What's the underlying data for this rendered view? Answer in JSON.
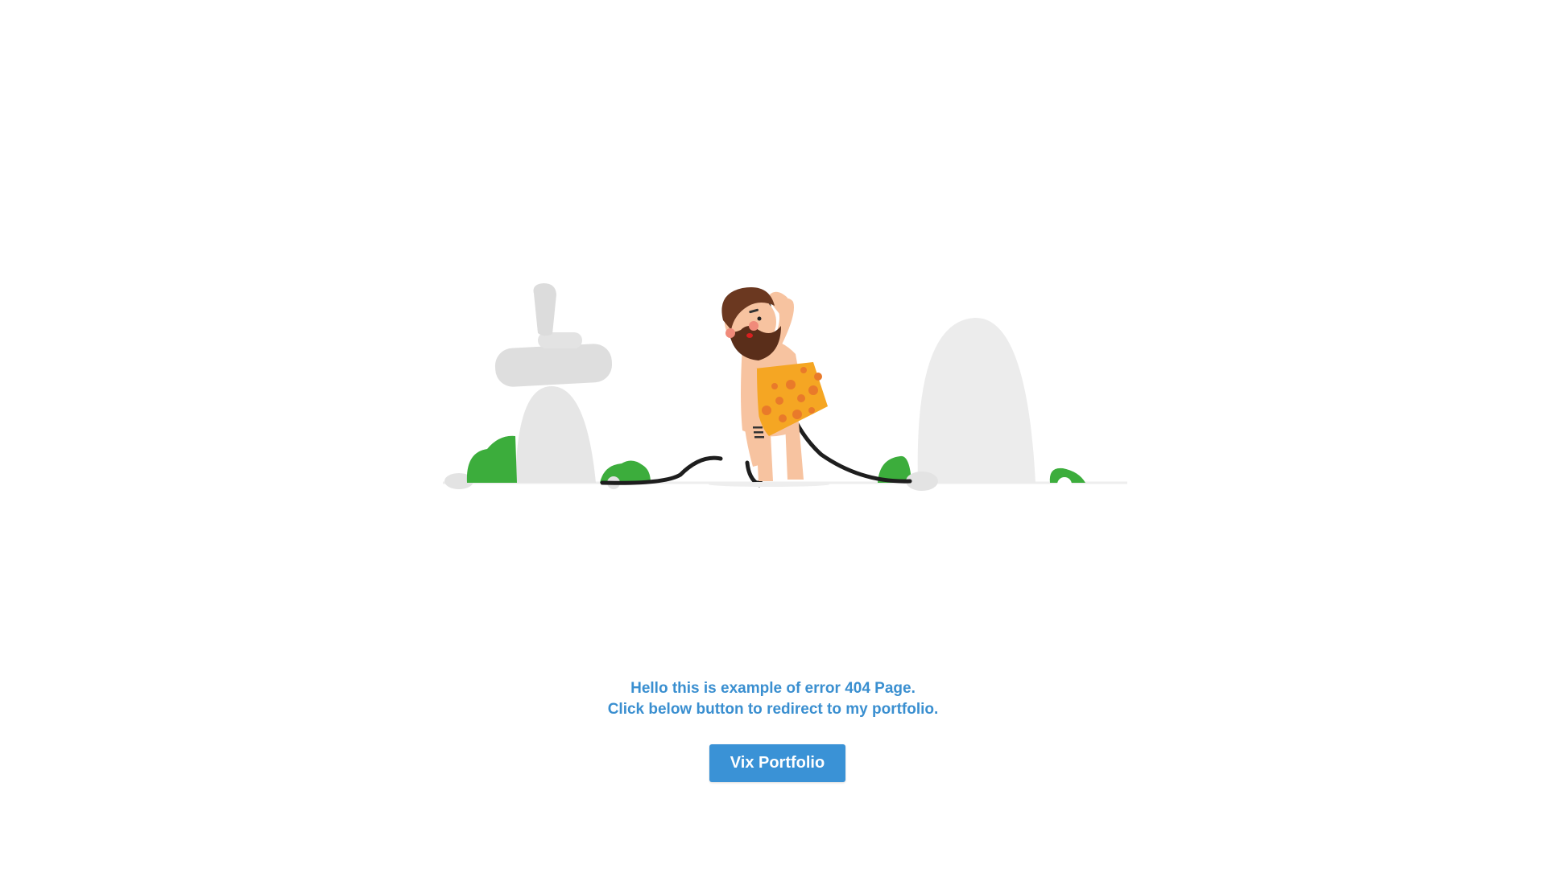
{
  "message": {
    "line1": "Hello this is example of error 404 Page.",
    "line2": "Click below button to redirect to my portfolio."
  },
  "button": {
    "label": "Vix Portfolio"
  },
  "illustration": {
    "subject": "caveman-pulling-cable-illustration",
    "colors": {
      "text_accent": "#3a8fd0",
      "button_bg": "#3a92d6",
      "rock": "#e3e3e3",
      "bush": "#3cad3c",
      "beard": "#5a2e1a",
      "skin": "#f7c3a0",
      "tunic": "#f5a623",
      "spots": "#e97a2a",
      "cable": "#1e1e1e"
    }
  }
}
